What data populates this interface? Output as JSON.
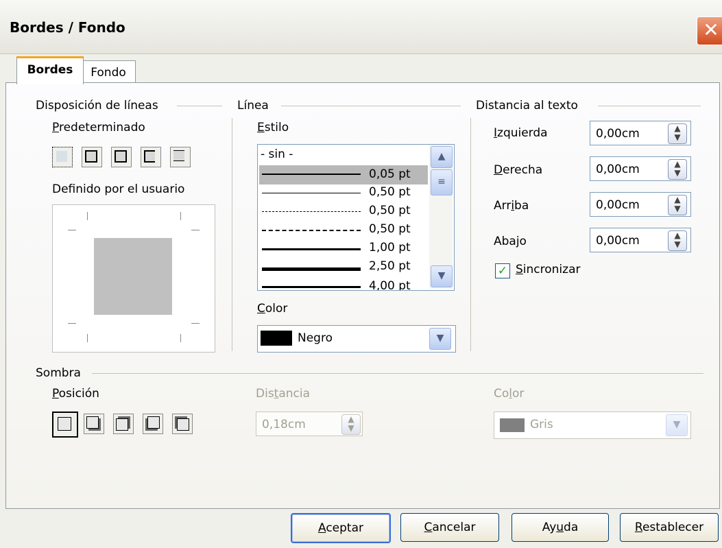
{
  "window": {
    "title": "Bordes / Fondo",
    "close_glyph": "✕"
  },
  "tabs": [
    {
      "label": "Bordes"
    },
    {
      "label": "Fondo"
    }
  ],
  "disposition": {
    "heading": "Disposición de líneas",
    "preset_label": "Predeterminado",
    "user_label": "Definido por el usuario"
  },
  "linea": {
    "heading": "Línea",
    "style_label": "Estilo",
    "styles": [
      {
        "label": "- sin -"
      },
      {
        "label": "0,05 pt"
      },
      {
        "label": "0,50 pt"
      },
      {
        "label": "0,50 pt"
      },
      {
        "label": "0,50 pt"
      },
      {
        "label": "1,00 pt"
      },
      {
        "label": "2,50 pt"
      },
      {
        "label": "4,00 pt"
      }
    ],
    "selected_style": "0,05 pt",
    "color_label": "Color",
    "color_value": "Negro",
    "color_swatch": "#000000"
  },
  "distance": {
    "heading": "Distancia al texto",
    "fields": [
      {
        "label": "Izquierda",
        "value": "0,00cm"
      },
      {
        "label": "Derecha",
        "value": "0,00cm"
      },
      {
        "label": "Arriba",
        "value": "0,00cm"
      },
      {
        "label": "Abajo",
        "value": "0,00cm"
      }
    ],
    "sync_label": "Sincronizar",
    "sync_checked": true
  },
  "shadow": {
    "heading": "Sombra",
    "position_label": "Posición",
    "distance_label": "Distancia",
    "distance_value": "0,18cm",
    "color_label": "Color",
    "color_value": "Gris",
    "color_swatch": "#808080"
  },
  "buttons": {
    "ok": "Aceptar",
    "cancel": "Cancelar",
    "help": "Ayuda",
    "reset": "Restablecer"
  }
}
